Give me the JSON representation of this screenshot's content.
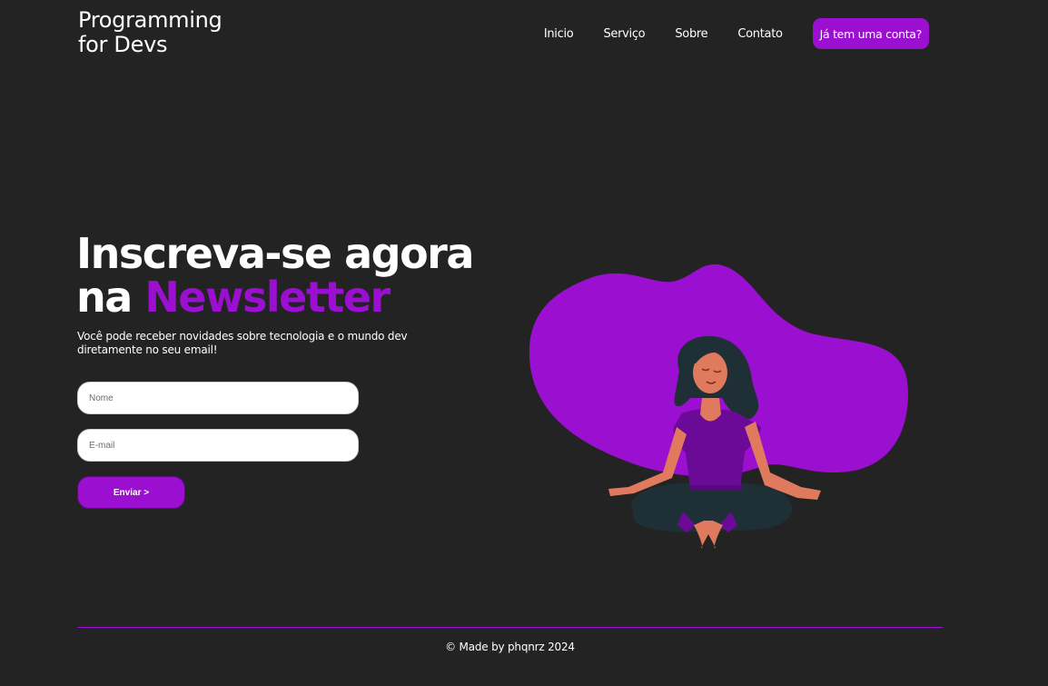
{
  "header": {
    "logo_line1": "Programming",
    "logo_line2": "for Devs",
    "nav": [
      {
        "label": "Inicio"
      },
      {
        "label": "Serviço"
      },
      {
        "label": "Sobre"
      },
      {
        "label": "Contato"
      }
    ],
    "account_button": "Já tem uma conta?"
  },
  "hero": {
    "title_line1": "Inscreva-se agora",
    "title_prefix": "na ",
    "title_accent": "Newsletter",
    "subtitle": "Você pode receber novidades sobre tecnologia e o mundo dev diretamente no seu email!",
    "form": {
      "name_placeholder": "Nome",
      "email_placeholder": "E-mail",
      "submit_label": "Enviar >"
    },
    "illustration_icon": "meditating-woman-illustration"
  },
  "footer": {
    "text": "© Made by phqnrz 2024"
  },
  "colors": {
    "background": "#232323",
    "accent": "#9b0fd1",
    "text": "#ffffff"
  }
}
